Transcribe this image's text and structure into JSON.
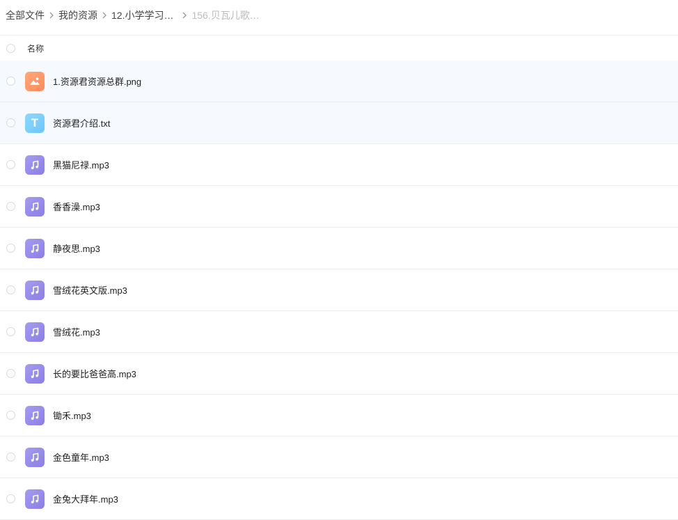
{
  "breadcrumb": {
    "items": [
      "全部文件",
      "我的资源",
      "12.小学学习…"
    ],
    "current": "156.贝瓦儿歌…"
  },
  "header": {
    "name_label": "名称"
  },
  "files": [
    {
      "name": "1.资源君资源总群.png",
      "icon": "image-file-icon"
    },
    {
      "name": "资源君介绍.txt",
      "icon": "text-file-icon",
      "icon_letter": "T"
    },
    {
      "name": "黑猫尼禄.mp3",
      "icon": "music-file-icon"
    },
    {
      "name": "香香澡.mp3",
      "icon": "music-file-icon"
    },
    {
      "name": "静夜思.mp3",
      "icon": "music-file-icon"
    },
    {
      "name": "雪绒花英文版.mp3",
      "icon": "music-file-icon"
    },
    {
      "name": "雪绒花.mp3",
      "icon": "music-file-icon"
    },
    {
      "name": "长的要比爸爸高.mp3",
      "icon": "music-file-icon"
    },
    {
      "name": "锄禾.mp3",
      "icon": "music-file-icon"
    },
    {
      "name": "金色童年.mp3",
      "icon": "music-file-icon"
    },
    {
      "name": "金兔大拜年.mp3",
      "icon": "music-file-icon"
    }
  ],
  "colors": {
    "image_icon": "#ff9a6a",
    "text_icon": "#7dcffd",
    "music_icon": "#968aeb",
    "highlight_row": "#f6f9fd"
  }
}
